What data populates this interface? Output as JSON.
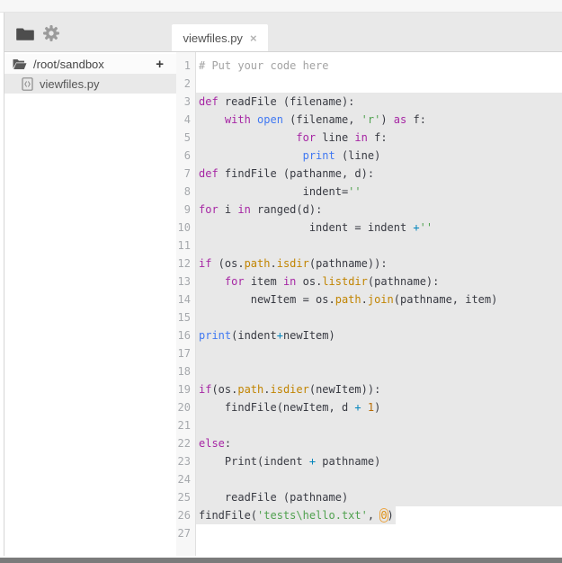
{
  "header": {
    "icons": [
      "folder-icon",
      "gear-icon"
    ],
    "tab": {
      "label": "viewfiles.py",
      "close_symbol": "×"
    }
  },
  "sidebar": {
    "root": {
      "label": "/root/sandbox",
      "add_symbol": "+",
      "icon": "folder-open-icon"
    },
    "files": [
      {
        "label": "viewfiles.py",
        "icon": "code-file-icon",
        "selected": true
      }
    ]
  },
  "colors": {
    "selection_bg": "#e8e8e8",
    "keyword": "#a626a4",
    "builtin": "#4078f2",
    "string": "#50a14f",
    "property": "#c18401",
    "number": "#b76b01",
    "operator": "#0184bc",
    "comment": "#a3a3a3",
    "default_text": "#383a42",
    "number_ring": "#eaa23e"
  },
  "editor": {
    "lines": [
      {
        "n": 1,
        "sel": false,
        "t": [
          [
            "c",
            "# Put your code here"
          ]
        ]
      },
      {
        "n": 2,
        "sel": false,
        "t": []
      },
      {
        "n": 3,
        "sel": true,
        "t": [
          [
            "k",
            "def"
          ],
          [
            "d",
            " readFile (filename):"
          ]
        ]
      },
      {
        "n": 4,
        "sel": true,
        "t": [
          [
            "d",
            "    "
          ],
          [
            "k",
            "with"
          ],
          [
            "d",
            " "
          ],
          [
            "b",
            "open"
          ],
          [
            "d",
            " (filename, "
          ],
          [
            "s",
            "'r'"
          ],
          [
            "d",
            ") "
          ],
          [
            "k",
            "as"
          ],
          [
            "d",
            " f:"
          ]
        ]
      },
      {
        "n": 5,
        "sel": true,
        "t": [
          [
            "d",
            "               "
          ],
          [
            "k",
            "for"
          ],
          [
            "d",
            " line "
          ],
          [
            "k",
            "in"
          ],
          [
            "d",
            " f:"
          ]
        ]
      },
      {
        "n": 6,
        "sel": true,
        "t": [
          [
            "d",
            "                "
          ],
          [
            "b",
            "print"
          ],
          [
            "d",
            " (line)"
          ]
        ]
      },
      {
        "n": 7,
        "sel": true,
        "t": [
          [
            "k",
            "def"
          ],
          [
            "d",
            " findFile (pathanme, d):"
          ]
        ]
      },
      {
        "n": 8,
        "sel": true,
        "t": [
          [
            "d",
            "                indent="
          ],
          [
            "s",
            "''"
          ]
        ]
      },
      {
        "n": 9,
        "sel": true,
        "t": [
          [
            "k",
            "for"
          ],
          [
            "d",
            " i "
          ],
          [
            "k",
            "in"
          ],
          [
            "d",
            " ranged(d):"
          ]
        ]
      },
      {
        "n": 10,
        "sel": true,
        "t": [
          [
            "d",
            "                 indent = indent "
          ],
          [
            "o",
            "+"
          ],
          [
            "s",
            "''"
          ]
        ]
      },
      {
        "n": 11,
        "sel": true,
        "t": []
      },
      {
        "n": 12,
        "sel": true,
        "t": [
          [
            "k",
            "if"
          ],
          [
            "d",
            " (os."
          ],
          [
            "p",
            "path"
          ],
          [
            "d",
            "."
          ],
          [
            "p",
            "isdir"
          ],
          [
            "d",
            "(pathname)):"
          ]
        ]
      },
      {
        "n": 13,
        "sel": true,
        "t": [
          [
            "d",
            "    "
          ],
          [
            "k",
            "for"
          ],
          [
            "d",
            " item "
          ],
          [
            "k",
            "in"
          ],
          [
            "d",
            " os."
          ],
          [
            "p",
            "listdir"
          ],
          [
            "d",
            "(pathname):"
          ]
        ]
      },
      {
        "n": 14,
        "sel": true,
        "t": [
          [
            "d",
            "        newItem = os."
          ],
          [
            "p",
            "path"
          ],
          [
            "d",
            "."
          ],
          [
            "p",
            "join"
          ],
          [
            "d",
            "(pathname, item)"
          ]
        ]
      },
      {
        "n": 15,
        "sel": true,
        "t": []
      },
      {
        "n": 16,
        "sel": true,
        "t": [
          [
            "b",
            "print"
          ],
          [
            "d",
            "(indent"
          ],
          [
            "o",
            "+"
          ],
          [
            "d",
            "newItem)"
          ]
        ]
      },
      {
        "n": 17,
        "sel": true,
        "t": []
      },
      {
        "n": 18,
        "sel": true,
        "t": []
      },
      {
        "n": 19,
        "sel": true,
        "t": [
          [
            "k",
            "if"
          ],
          [
            "d",
            "(os."
          ],
          [
            "p",
            "path"
          ],
          [
            "d",
            "."
          ],
          [
            "p",
            "isdier"
          ],
          [
            "d",
            "(newItem)):"
          ]
        ]
      },
      {
        "n": 20,
        "sel": true,
        "t": [
          [
            "d",
            "    findFile(newItem, d "
          ],
          [
            "o",
            "+"
          ],
          [
            "d",
            " "
          ],
          [
            "n",
            "1"
          ],
          [
            "d",
            ")"
          ]
        ]
      },
      {
        "n": 21,
        "sel": true,
        "t": []
      },
      {
        "n": 22,
        "sel": true,
        "t": [
          [
            "k",
            "else"
          ],
          [
            "d",
            ":"
          ]
        ]
      },
      {
        "n": 23,
        "sel": true,
        "t": [
          [
            "d",
            "    Print(indent "
          ],
          [
            "o",
            "+"
          ],
          [
            "d",
            " pathname)"
          ]
        ]
      },
      {
        "n": 24,
        "sel": true,
        "t": []
      },
      {
        "n": 25,
        "sel": true,
        "t": [
          [
            "d",
            "    readFile (pathname)"
          ]
        ]
      },
      {
        "n": 26,
        "sel": "partial",
        "t": [
          [
            "d",
            "findFile("
          ],
          [
            "s",
            "'tests\\hello.txt'"
          ],
          [
            "d",
            ", "
          ],
          [
            "n0",
            "0"
          ],
          [
            "d",
            ")"
          ]
        ]
      },
      {
        "n": 27,
        "sel": false,
        "t": []
      }
    ]
  }
}
